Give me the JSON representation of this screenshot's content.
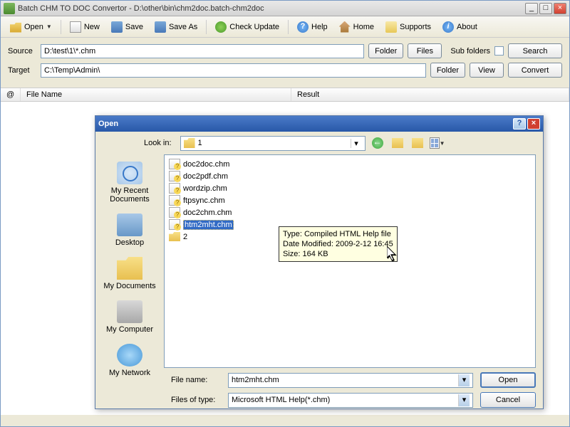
{
  "window": {
    "title": "Batch CHM TO DOC Convertor - D:\\other\\bin\\chm2doc.batch-chm2doc",
    "min": "_",
    "max": "□",
    "close": "×"
  },
  "toolbar": {
    "open": "Open",
    "new": "New",
    "save": "Save",
    "saveas": "Save As",
    "check": "Check Update",
    "help": "Help",
    "home": "Home",
    "supports": "Supports",
    "about": "About"
  },
  "form": {
    "source_label": "Source",
    "source_value": "D:\\test\\1\\*.chm",
    "target_label": "Target",
    "target_value": "C:\\Temp\\Admin\\",
    "folder_btn": "Folder",
    "files_btn": "Files",
    "view_btn": "View",
    "subfolders_label": "Sub folders",
    "search_btn": "Search",
    "convert_btn": "Convert"
  },
  "list": {
    "col_at": "@",
    "col_filename": "File Name",
    "col_result": "Result"
  },
  "dialog": {
    "title": "Open",
    "help": "?",
    "close": "×",
    "lookin_label": "Look in:",
    "lookin_value": "1",
    "places": {
      "recent": "My Recent Documents",
      "desktop": "Desktop",
      "mydocs": "My Documents",
      "mycomp": "My Computer",
      "network": "My Network"
    },
    "files": [
      {
        "name": "doc2doc.chm",
        "type": "file"
      },
      {
        "name": "doc2pdf.chm",
        "type": "file"
      },
      {
        "name": "wordzip.chm",
        "type": "file"
      },
      {
        "name": "ftpsync.chm",
        "type": "file"
      },
      {
        "name": "doc2chm.chm",
        "type": "file"
      },
      {
        "name": "htm2mht.chm",
        "type": "file",
        "selected": true
      },
      {
        "name": "2",
        "type": "folder"
      }
    ],
    "tooltip": {
      "line1": "Type: Compiled HTML Help file",
      "line2": "Date Modified: 2009-2-12 16:45",
      "line3": "Size: 164 KB"
    },
    "filename_label": "File name:",
    "filename_value": "htm2mht.chm",
    "filetype_label": "Files of type:",
    "filetype_value": "Microsoft HTML Help(*.chm)",
    "open_btn": "Open",
    "cancel_btn": "Cancel"
  }
}
